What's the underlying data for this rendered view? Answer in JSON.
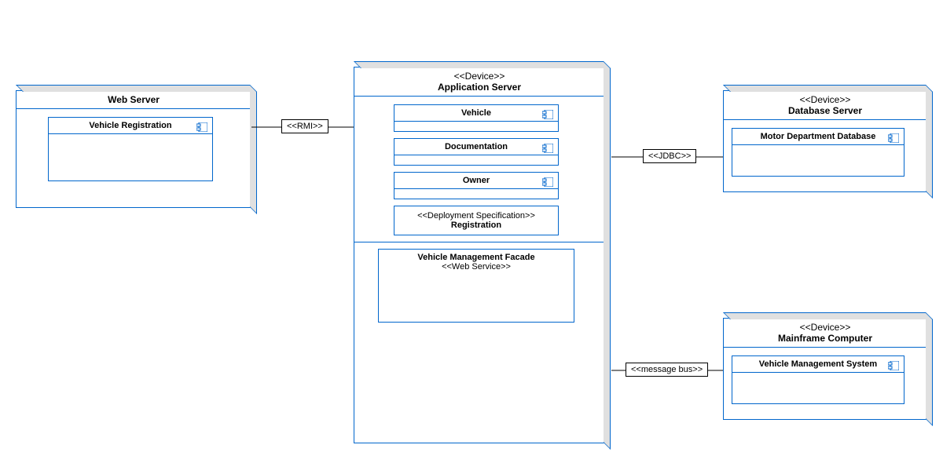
{
  "nodes": {
    "web_server": {
      "title": "Web Server",
      "artifacts": {
        "vehicle_registration": "Vehicle Registration"
      }
    },
    "app_server": {
      "stereotype": "<<Device>>",
      "title": "Application Server",
      "artifacts": {
        "vehicle": "Vehicle",
        "documentation": "Documentation",
        "owner": "Owner"
      },
      "spec": {
        "stereotype": "<<Deployment Specification>>",
        "title": "Registration"
      },
      "service": {
        "title": "Vehicle Management Facade",
        "stereotype": "<<Web Service>>"
      }
    },
    "db_server": {
      "stereotype": "<<Device>>",
      "title": "Database Server",
      "artifacts": {
        "motor_db": "Motor Department Database"
      }
    },
    "mainframe": {
      "stereotype": "<<Device>>",
      "title": "Mainframe Computer",
      "artifacts": {
        "vms": "Vehicle Management System"
      }
    }
  },
  "connectors": {
    "rmi": "<<RMI>>",
    "jdbc": "<<JDBC>>",
    "msgbus": "<<message bus>>"
  }
}
